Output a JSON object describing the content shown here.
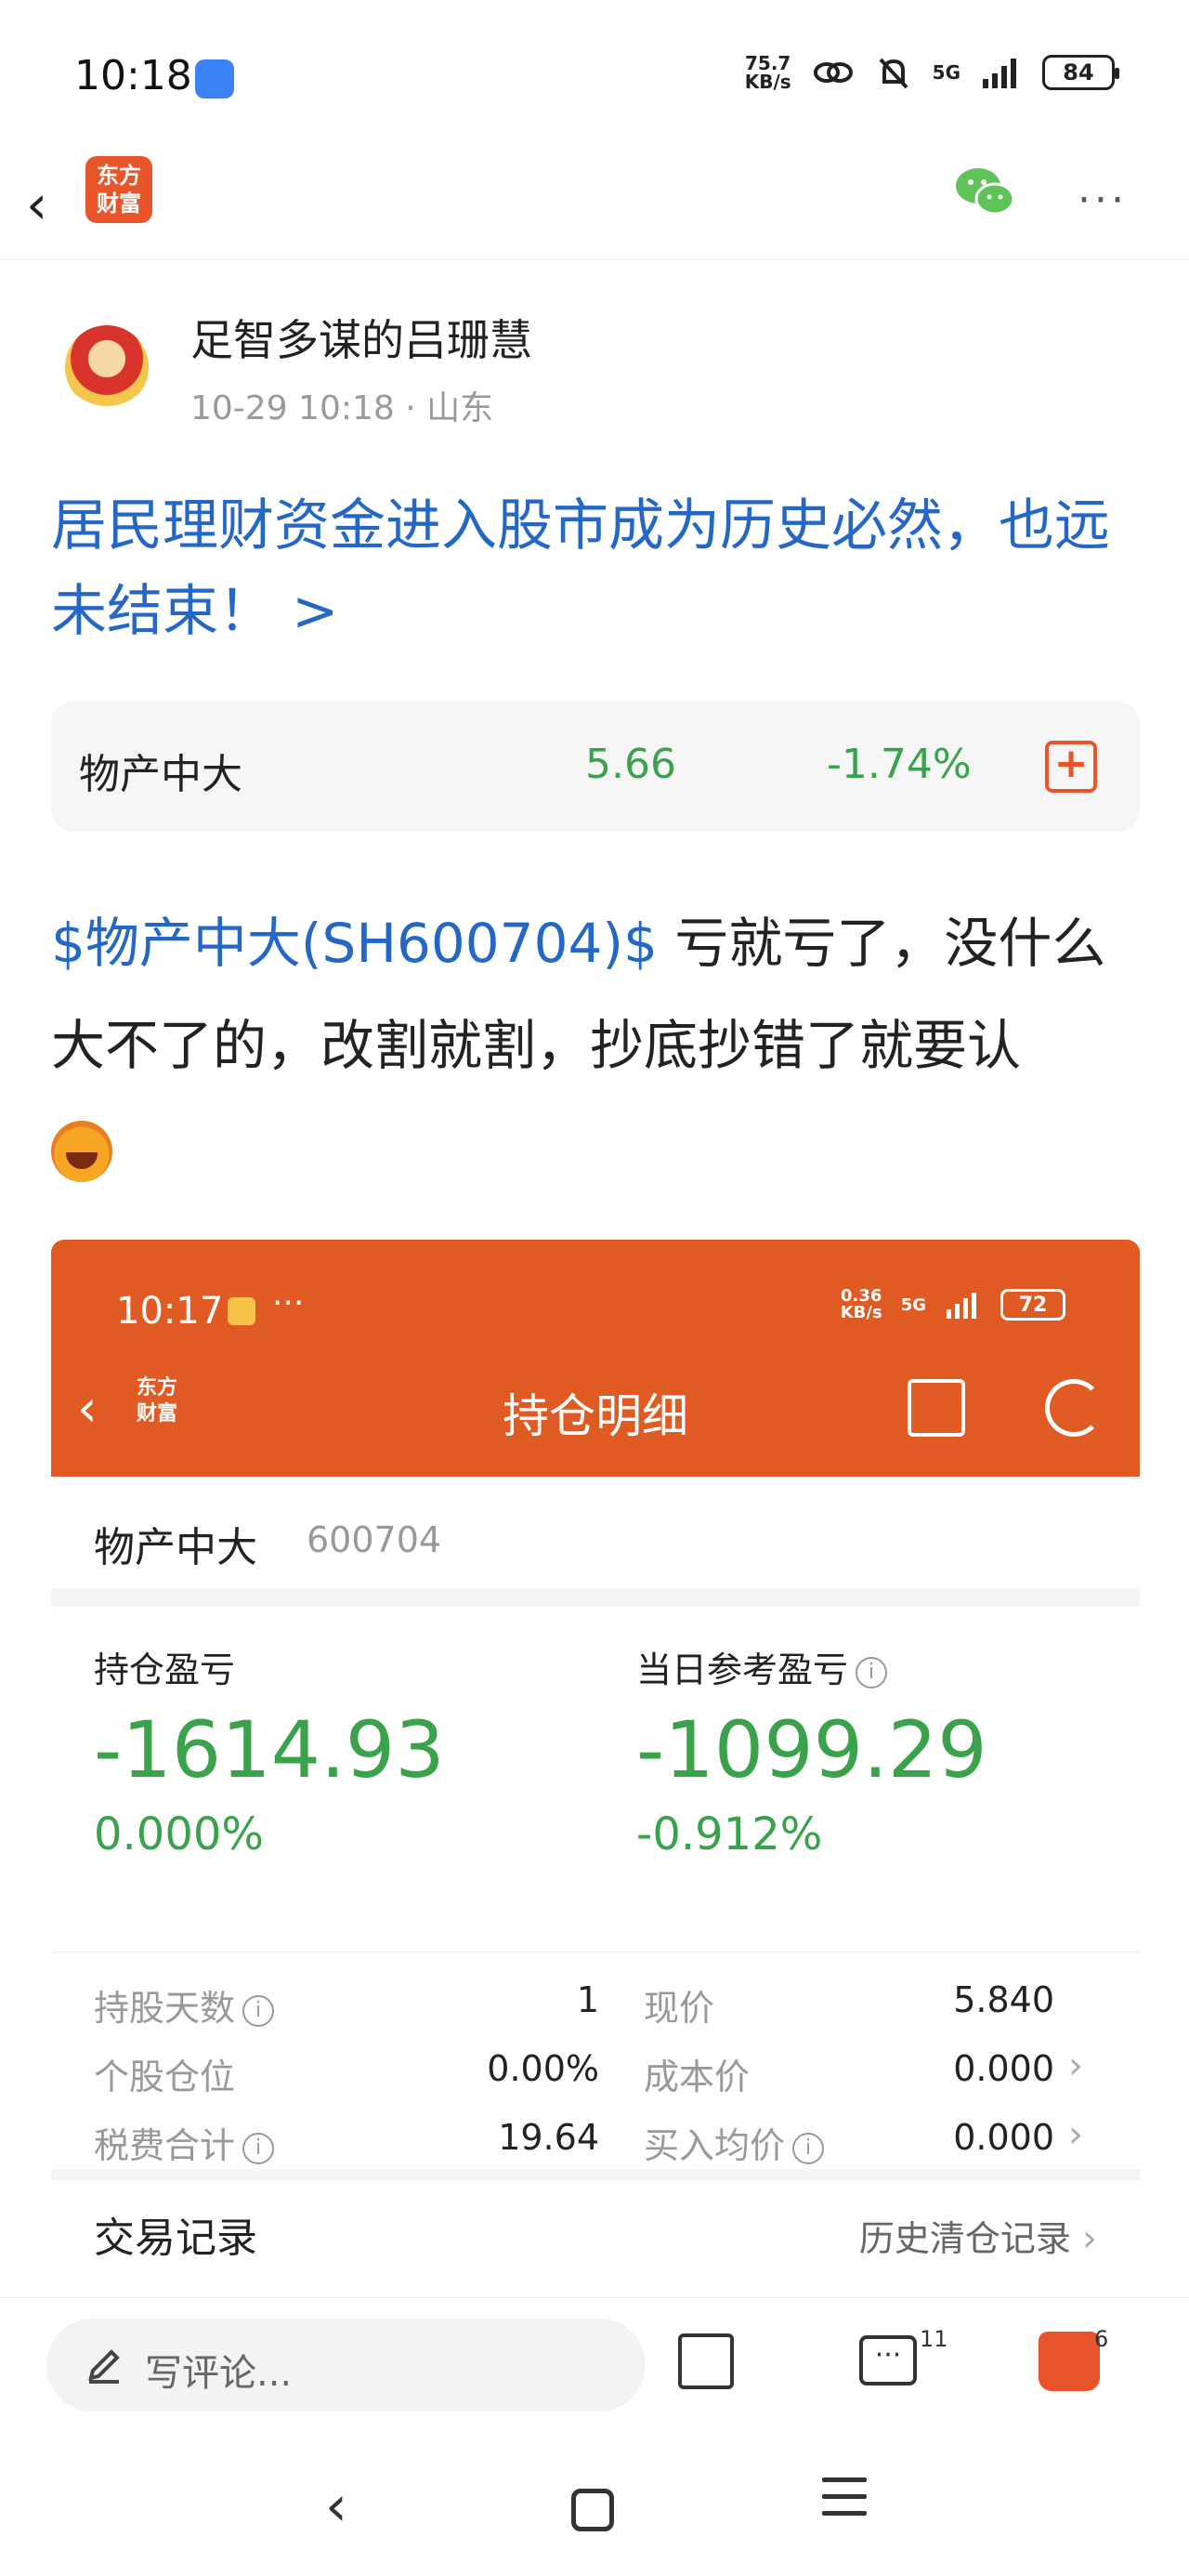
{
  "status_bar": {
    "time": "10:18",
    "net_speed_top": "75.7",
    "net_speed_bottom": "KB/s",
    "network": "5G",
    "battery": "84"
  },
  "nav": {
    "logo_line1": "东方",
    "logo_line2": "财富"
  },
  "author": {
    "name": "足智多谋的吕珊慧",
    "meta": "10-29 10:18  · 山东"
  },
  "post": {
    "title": "居民理财资金进入股市成为历史必然，也远未结束！ >",
    "stock_tag": "$物产中大(SH600704)$",
    "body_text": " 亏就亏了，没什么大不了的，改割就割，抄底抄错了就要认"
  },
  "stock_card": {
    "name": "物产中大",
    "price": "5.66",
    "change": "-1.74%",
    "add_symbol": "+"
  },
  "embed": {
    "time": "10:17",
    "dots": "···",
    "net_top": "0.36",
    "net_bottom": "KB/s",
    "network": "5G",
    "battery": "72",
    "logo_line1": "东方",
    "logo_line2": "财富",
    "title": "持仓明细",
    "stock_name": "物产中大",
    "stock_code": "600704",
    "holding_pl_label": "持仓盈亏",
    "holding_pl_value": "-1614.93",
    "holding_pl_pct": "0.000%",
    "daily_pl_label": "当日参考盈亏",
    "daily_pl_value": "-1099.29",
    "daily_pl_pct": "-0.912%",
    "info_symbol": "i",
    "rows": [
      {
        "label": "持股天数",
        "value": "1",
        "r_label": "现价",
        "r_value": "5.840"
      },
      {
        "label": "个股仓位",
        "value": "0.00%",
        "r_label": "成本价",
        "r_value": "0.000"
      },
      {
        "label": "税费合计",
        "value": "19.64",
        "r_label": "买入均价",
        "r_value": "0.000"
      }
    ],
    "trade_title": "交易记录",
    "trade_link": "历史清仓记录"
  },
  "bottom_bar": {
    "comment_placeholder": "写评论...",
    "comment_count": "11",
    "like_count": "6"
  }
}
